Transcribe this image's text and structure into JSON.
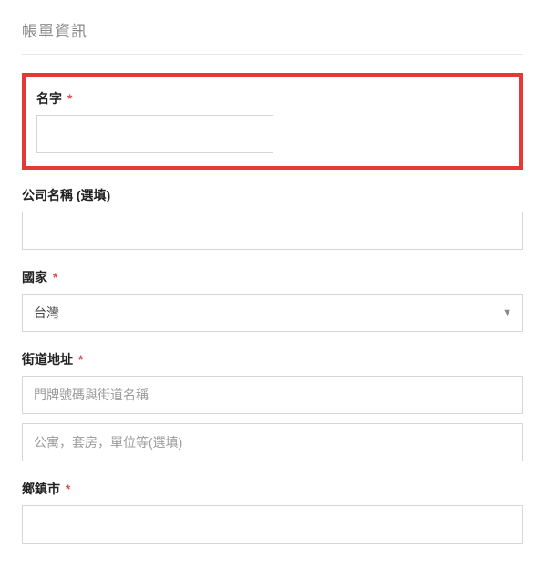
{
  "section_title": "帳單資訊",
  "fields": {
    "name": {
      "label": "名字",
      "required_mark": "*",
      "value": ""
    },
    "company": {
      "label": "公司名稱 (選填)",
      "value": ""
    },
    "country": {
      "label": "國家",
      "required_mark": "*",
      "selected": "台灣"
    },
    "street": {
      "label": "街道地址",
      "required_mark": "*",
      "placeholder1": "門牌號碼與街道名稱",
      "placeholder2": "公寓，套房，單位等(選填)",
      "value1": "",
      "value2": ""
    },
    "city": {
      "label": "鄉鎮市",
      "required_mark": "*",
      "value": ""
    }
  }
}
